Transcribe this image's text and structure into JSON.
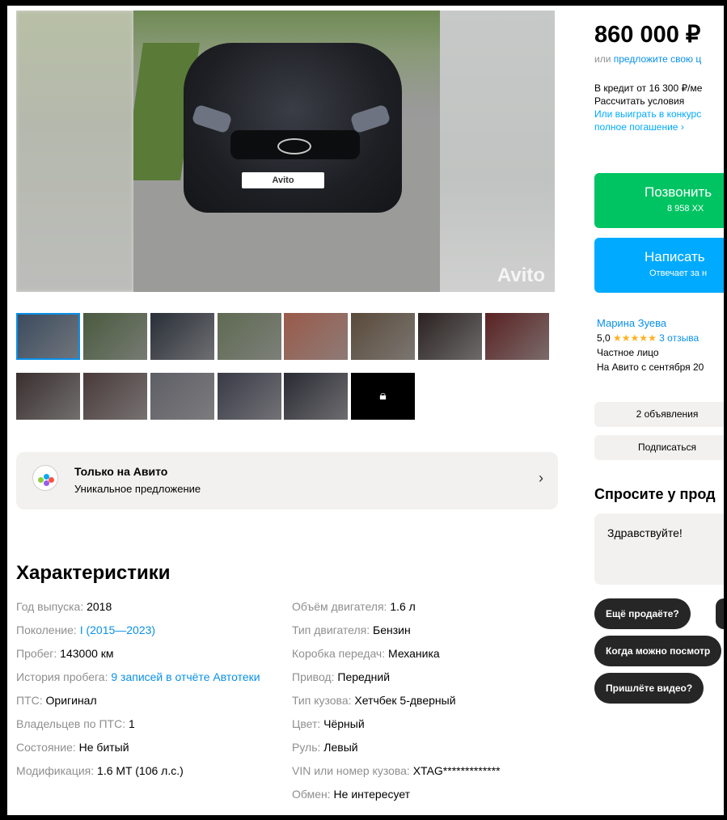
{
  "gallery": {
    "main_photo": {
      "description": "Black hatchback car front view",
      "plate_text": "Avito",
      "watermark": "Avito"
    },
    "thumbnails": [
      {
        "icon": "photo-thumb",
        "tone": "#3a4a5e"
      },
      {
        "icon": "photo-thumb",
        "tone": "#4a5a3e"
      },
      {
        "icon": "photo-thumb",
        "tone": "#2a2f38"
      },
      {
        "icon": "photo-thumb",
        "tone": "#5f6a52"
      },
      {
        "icon": "photo-thumb",
        "tone": "#9a5a4a"
      },
      {
        "icon": "photo-thumb",
        "tone": "#5a4a3a"
      },
      {
        "icon": "photo-thumb",
        "tone": "#2a2220"
      },
      {
        "icon": "photo-thumb",
        "tone": "#5a2222"
      },
      {
        "icon": "photo-thumb",
        "tone": "#3a2f2f"
      },
      {
        "icon": "photo-thumb",
        "tone": "#4a3a3a"
      },
      {
        "icon": "photo-thumb",
        "tone": "#5e5e66"
      },
      {
        "icon": "photo-thumb",
        "tone": "#3a3a48"
      },
      {
        "icon": "photo-thumb",
        "tone": "#2a2a34"
      },
      {
        "icon": "lock-icon",
        "tone": "#000000"
      }
    ]
  },
  "promo": {
    "title": "Только на Авито",
    "subtitle": "Уникальное предложение",
    "arrow": "›"
  },
  "characteristics": {
    "title": "Характеристики",
    "left": [
      {
        "label": "Год выпуска:",
        "value": "2018"
      },
      {
        "label": "Поколение:",
        "link": "I (2015—2023)"
      },
      {
        "label": "Пробег:",
        "value": "143000 км"
      },
      {
        "label": "История пробега:",
        "link": "9 записей в отчёте Автотеки"
      },
      {
        "label": "ПТС:",
        "value": "Оригинал"
      },
      {
        "label": "Владельцев по ПТС:",
        "value": "1"
      },
      {
        "label": "Состояние:",
        "value": "Не битый"
      },
      {
        "label": "Модификация:",
        "value": "1.6 MT (106 л.с.)"
      }
    ],
    "right": [
      {
        "label": "Объём двигателя:",
        "value": "1.6 л"
      },
      {
        "label": "Тип двигателя:",
        "value": "Бензин"
      },
      {
        "label": "Коробка передач:",
        "value": "Механика"
      },
      {
        "label": "Привод:",
        "value": "Передний"
      },
      {
        "label": "Тип кузова:",
        "value": "Хетчбек 5-дверный"
      },
      {
        "label": "Цвет:",
        "value": "Чёрный"
      },
      {
        "label": "Руль:",
        "value": "Левый"
      },
      {
        "label": "VIN или номер кузова:",
        "value": "XTAG*************"
      },
      {
        "label": "Обмен:",
        "value": "Не интересует"
      }
    ]
  },
  "sidebar": {
    "price": "860 000 ₽",
    "offer_prefix": "или ",
    "offer_link": "предложите свою ц",
    "credit_line1": "В кредит от 16 300 ₽/ме",
    "credit_line2": "Рассчитать условия",
    "credit_line3": "Или выиграть в конкурс",
    "credit_line4": "полное погашение ›",
    "call_button": "Позвонить",
    "call_phone": "8 958 XX",
    "message_button": "Написать",
    "message_sub": "Отвечает за н",
    "seller_name": "Марина Зуева",
    "rating": "5,0",
    "stars": "★★★★★",
    "reviews": "3 отзыва",
    "seller_type": "Частное лицо",
    "since": "На Авито с сентября 20",
    "ads_button": "2 объявления",
    "subscribe_button": "Подписаться",
    "ask_title": "Спросите у прод",
    "message_text": "Здравствуйте!",
    "chips": [
      "Ещё продаёте?",
      "Когда можно посмотр",
      "Пришлёте видео?"
    ]
  }
}
